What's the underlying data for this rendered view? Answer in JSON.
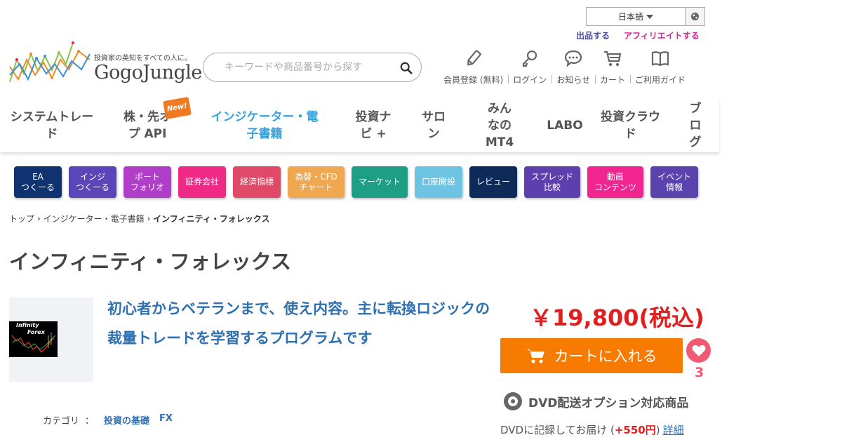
{
  "header": {
    "language": "日本語",
    "sell_link": "出品する",
    "affiliate_link": "アフィリエイトする",
    "tagline": "投資家の英知をすべての人に。",
    "brand": "GogoJungle",
    "search_placeholder": "キーワードや商品番号から探す",
    "icons": [
      {
        "label": "会員登録 (無料)",
        "icon": "pencil-icon"
      },
      {
        "label": "ログイン",
        "icon": "key-icon"
      },
      {
        "label": "お知らせ",
        "icon": "speech-bubble-icon"
      },
      {
        "label": "カート",
        "icon": "cart-icon"
      },
      {
        "label": "ご利用ガイド",
        "icon": "book-icon"
      }
    ]
  },
  "nav": {
    "items": [
      {
        "label": "システムトレード"
      },
      {
        "label": "株・先オプ API",
        "badge": "New!"
      },
      {
        "label": "インジケーター・電子書籍",
        "active": true
      },
      {
        "label": "投資ナビ +"
      },
      {
        "label": "サロン"
      },
      {
        "label": "みんなの MT4"
      },
      {
        "label": "LABO"
      },
      {
        "label": "投資クラウド"
      },
      {
        "label": "ブログ"
      }
    ]
  },
  "categories": [
    {
      "line1": "EA",
      "line2": "つくーる",
      "color": "#0f3370"
    },
    {
      "line1": "インジ",
      "line2": "つくーる",
      "color": "#5a46b8"
    },
    {
      "line1": "ポート",
      "line2": "フォリオ",
      "color": "#b03ec8"
    },
    {
      "line1": "証券会社",
      "line2": "",
      "color": "#ee2a86"
    },
    {
      "line1": "経済指標",
      "line2": "",
      "color": "#e04a68"
    },
    {
      "line1": "為替・CFD",
      "line2": "チャート",
      "color": "#f0a850"
    },
    {
      "line1": "マーケット",
      "line2": "",
      "color": "#1f9e86"
    },
    {
      "line1": "口座開設",
      "line2": "",
      "color": "#6cc4e2"
    },
    {
      "line1": "レビュー",
      "line2": "",
      "color": "#0d2a58"
    },
    {
      "line1": "スプレッド",
      "line2": "比較",
      "color": "#5e3fae"
    },
    {
      "line1": "動画",
      "line2": "コンテンツ",
      "color": "#f0258f"
    },
    {
      "line1": "イベント",
      "line2": "情報",
      "color": "#5b43ae"
    }
  ],
  "breadcrumb": {
    "top": "トップ",
    "parent": "インジケーター・電子書籍",
    "current": "インフィニティ・フォレックス"
  },
  "product": {
    "title": "インフィニティ・フォレックス",
    "thumb_text_1": "Infinity",
    "thumb_text_2": "Forex",
    "headline": "初心者からベテランまで、使え内容。主に転換ロジックの裁量トレードを学習するプログラムです",
    "category_label": "カテゴリ",
    "category_colon": "：",
    "category_1": "投資の基礎",
    "category_2": "FX",
    "price": "￥19,800(税込)",
    "cart_label": "カートに入れる",
    "favorite_count": "3",
    "dvd_title": "DVD配送オプション対応商品",
    "dvd_note_prefix": "DVDに記録してお届け (",
    "dvd_extra": "+550円",
    "dvd_note_suffix": ")",
    "dvd_detail": "詳細"
  }
}
